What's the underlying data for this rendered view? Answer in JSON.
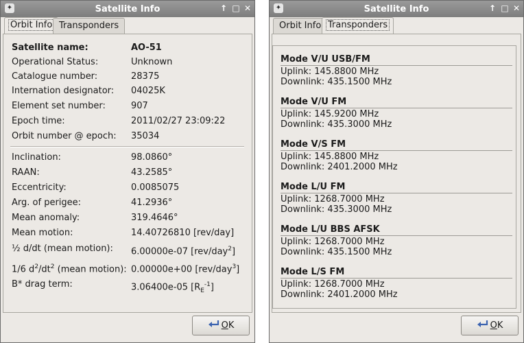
{
  "left_window": {
    "title": "Satellite Info",
    "tabs": [
      "Orbit Info",
      "Transponders"
    ],
    "ok_button": {
      "accel": "O",
      "rest": "K"
    },
    "info": [
      {
        "key": "Satellite name:",
        "value": "AO-51"
      },
      {
        "key": "Operational Status:",
        "value": "Unknown"
      },
      {
        "key": "Catalogue number:",
        "value": "28375"
      },
      {
        "key": "Internation designator:",
        "value": "04025K"
      },
      {
        "key": "Element set number:",
        "value": "907"
      },
      {
        "key": "Epoch time:",
        "value": "2011/02/27 23:09:22"
      },
      {
        "key": "Orbit number @ epoch:",
        "value": "35034"
      }
    ],
    "elements": [
      {
        "key": "Inclination:",
        "value": "98.0860°"
      },
      {
        "key": "RAAN:",
        "value": "43.2585°"
      },
      {
        "key": "Eccentricity:",
        "value": "0.0085075"
      },
      {
        "key": "Arg. of perigee:",
        "value": "41.2936°"
      },
      {
        "key": "Mean anomaly:",
        "value": "319.4646°"
      },
      {
        "key": "Mean motion:",
        "value": "14.40726810 [rev/day]"
      }
    ],
    "deriv1": {
      "key": "½ d/dt (mean motion):",
      "value": "6.00000e-07 [rev/day",
      "sup": "2",
      "tail": "]"
    },
    "deriv2": {
      "key_a": "1/6 d",
      "key_sup1": "2",
      "key_b": "/dt",
      "key_sup2": "2",
      "key_c": " (mean motion):",
      "value": "0.00000e+00 [rev/day",
      "sup": "3",
      "tail": "]"
    },
    "drag": {
      "key": "B* drag term:",
      "value": "3.06400e-05 [R",
      "sub": "E",
      "sup": "-1",
      "tail": "]"
    }
  },
  "right_window": {
    "title": "Satellite Info",
    "tabs": [
      "Orbit Info",
      "Transponders"
    ],
    "ok_button": {
      "accel": "O",
      "rest": "K"
    },
    "modes": [
      {
        "name": "Mode V/U USB/FM",
        "uplink": "Uplink: 145.8800 MHz",
        "downlink": "Downlink: 435.1500 MHz"
      },
      {
        "name": "Mode V/U FM",
        "uplink": "Uplink: 145.9200 MHz",
        "downlink": "Downlink: 435.3000 MHz"
      },
      {
        "name": "Mode V/S FM",
        "uplink": "Uplink: 145.8800 MHz",
        "downlink": "Downlink: 2401.2000 MHz"
      },
      {
        "name": "Mode L/U FM",
        "uplink": "Uplink: 1268.7000 MHz",
        "downlink": "Downlink: 435.3000 MHz"
      },
      {
        "name": "Mode L/U BBS AFSK",
        "uplink": "Uplink: 1268.7000 MHz",
        "downlink": "Downlink: 435.1500 MHz"
      },
      {
        "name": "Mode L/S FM",
        "uplink": "Uplink: 1268.7000 MHz",
        "downlink": "Downlink: 2401.2000 MHz"
      }
    ]
  }
}
